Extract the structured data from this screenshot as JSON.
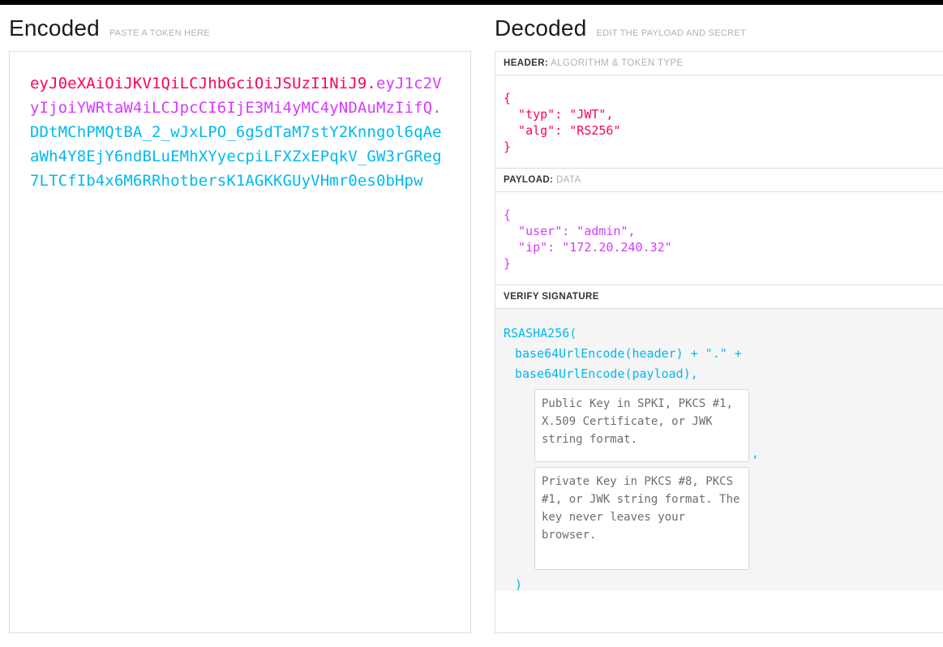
{
  "panels": {
    "encoded": {
      "title": "Encoded",
      "subtitle": "PASTE A TOKEN HERE",
      "token": {
        "header": "eyJ0eXAiOiJKV1QiLCJhbGciOiJSUzI1NiJ9",
        "dot1": ".",
        "payload": "eyJ1c2VyIjoiYWRtaW4iLCJpcCI6IjE3Mi4yMC4yNDAuMzIifQ",
        "dot2": ".",
        "signature": "DDtMChPMQtBA_2_wJxLPO_6g5dTaM7stY2Knngol6qAeaWh4Y8EjY6ndBLuEMhXYyecpiLFXZxEPqkV_GW3rGReg7LTCfIb4x6M6RRhotbersK1AGKKGUyVHmr0es0bHpw",
        "full": "eyJ0eXAiOiJKV1QiLCJhbGciOiJSUzI1NiJ9.eyJ1c2VyIjoiYWRtaW4iLCJpcCI6IjE3Mi4yMC4yNDAuMzIifQ.DDtMChPMQtBA_2_wJxLPO_6g5dTaM7stY2Knngol6qAeaWh4Y8EjY6ndBLuEMhXYyecpiLFXZxEPqkV_GW3rGReg7LTCfIb4x6M6RRhotbersK1AGKKGUyVHmr0es0bHpw"
      }
    },
    "decoded": {
      "title": "Decoded",
      "subtitle": "EDIT THE PAYLOAD AND SECRET",
      "sections": {
        "header": {
          "label": "HEADER:",
          "hint": "ALGORITHM & TOKEN TYPE",
          "json": "{\n  \"typ\": \"JWT\",\n  \"alg\": \"RS256\"\n}"
        },
        "payload": {
          "label": "PAYLOAD:",
          "hint": "DATA",
          "json": "{\n  \"user\": \"admin\",\n  \"ip\": \"172.20.240.32\"\n}"
        },
        "verify": {
          "label": "VERIFY SIGNATURE",
          "hint": "",
          "line1": "RSASHA256(",
          "line2": "base64UrlEncode(header) + \".\" +",
          "line3": "base64UrlEncode(payload),",
          "comma": ",",
          "close": ")",
          "public_key_placeholder": "Public Key in SPKI, PKCS #1, X.509 Certificate, or JWK string format.",
          "public_key_value": "",
          "private_key_placeholder": "Private Key in PKCS #8, PKCS #1, or JWK string format. The key never leaves your browser.",
          "private_key_value": ""
        }
      }
    }
  },
  "colors": {
    "header_segment": "#fb015b",
    "payload_segment": "#d63aff",
    "signature_segment": "#00b9f1",
    "border": "#dedede",
    "hint_text": "#b1b1b1",
    "verify_background": "#f5f5f5"
  }
}
